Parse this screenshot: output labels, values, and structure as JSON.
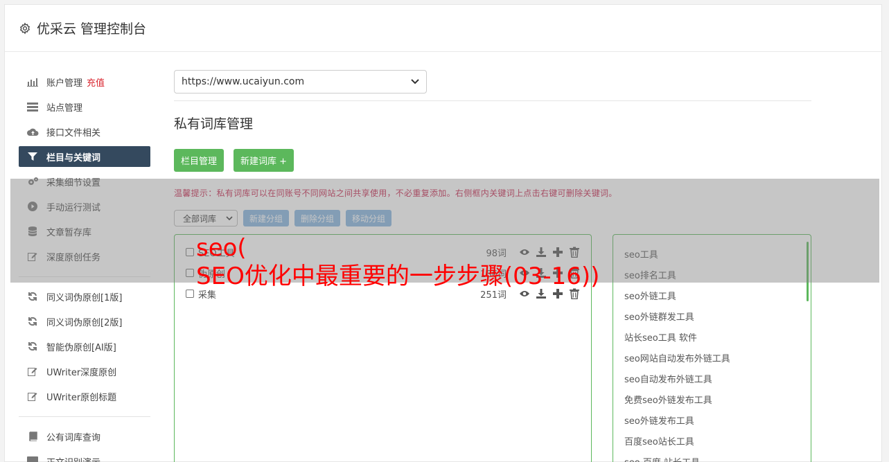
{
  "header": {
    "title": "优采云 管理控制台",
    "icon": "gear-icon"
  },
  "sidebar": {
    "group1": [
      {
        "label": "账户管理",
        "badge": "充值",
        "icon": "bar-chart-icon"
      },
      {
        "label": "站点管理",
        "icon": "server-icon"
      },
      {
        "label": "接口文件相关",
        "icon": "cloud-upload-icon"
      },
      {
        "label": "栏目与关键词",
        "icon": "filter-icon",
        "active": true
      },
      {
        "label": "采集细节设置",
        "icon": "cogs-icon"
      },
      {
        "label": "手动运行测试",
        "icon": "play-circle-icon"
      },
      {
        "label": "文章暂存库",
        "icon": "database-icon"
      },
      {
        "label": "深度原创任务",
        "icon": "edit-icon"
      }
    ],
    "group2": [
      {
        "label": "同义词伪原创[1版]",
        "icon": "refresh-icon"
      },
      {
        "label": "同义词伪原创[2版]",
        "icon": "refresh-icon"
      },
      {
        "label": "智能伪原创[AI版]",
        "icon": "refresh-icon"
      },
      {
        "label": "UWriter深度原创",
        "icon": "edit-icon"
      },
      {
        "label": "UWriter原创标题",
        "icon": "edit-icon"
      }
    ],
    "group3": [
      {
        "label": "公有词库查询",
        "icon": "book-icon"
      },
      {
        "label": "正文识别演示",
        "icon": "monitor-icon"
      }
    ]
  },
  "main": {
    "site_select": "https://www.ucaiyun.com",
    "heading": "私有词库管理",
    "buttons": {
      "column_manage": "栏目管理",
      "new_library": "新建词库 +"
    },
    "tip": "温馨提示：私有词库可以在同账号不同网站之间共享使用，不必重复添加。右侧框内关键词上点击右键可删除关键词。",
    "filter_select": "全部词库",
    "group_buttons": {
      "new_group": "新建分组",
      "delete_group": "删除分组",
      "move_group": "移动分组"
    },
    "libraries": [
      {
        "name": "SEO工具",
        "count": "98词"
      },
      {
        "name": "伪原创",
        "count": "186词"
      },
      {
        "name": "采集",
        "count": "251词"
      }
    ],
    "keywords": [
      "seo工具",
      "seo排名工具",
      "seo外链工具",
      "seo外链群发工具",
      "站长seo工具 软件",
      "seo网站自动发布外链工具",
      "seo自动发布外链工具",
      "免费seo外链发布工具",
      "seo外链发布工具",
      "百度seo站长工具",
      "seo 百度 站长工具"
    ]
  },
  "overlay_text": {
    "line1": "seo(",
    "line2": "SEO优化中最重要的一步步骤(03-16))"
  },
  "colors": {
    "active_nav": "#34495e",
    "green": "#5cb85c",
    "blue": "#85b4e0",
    "overlay_text": "#ff0000",
    "badge": "#d9232d"
  }
}
